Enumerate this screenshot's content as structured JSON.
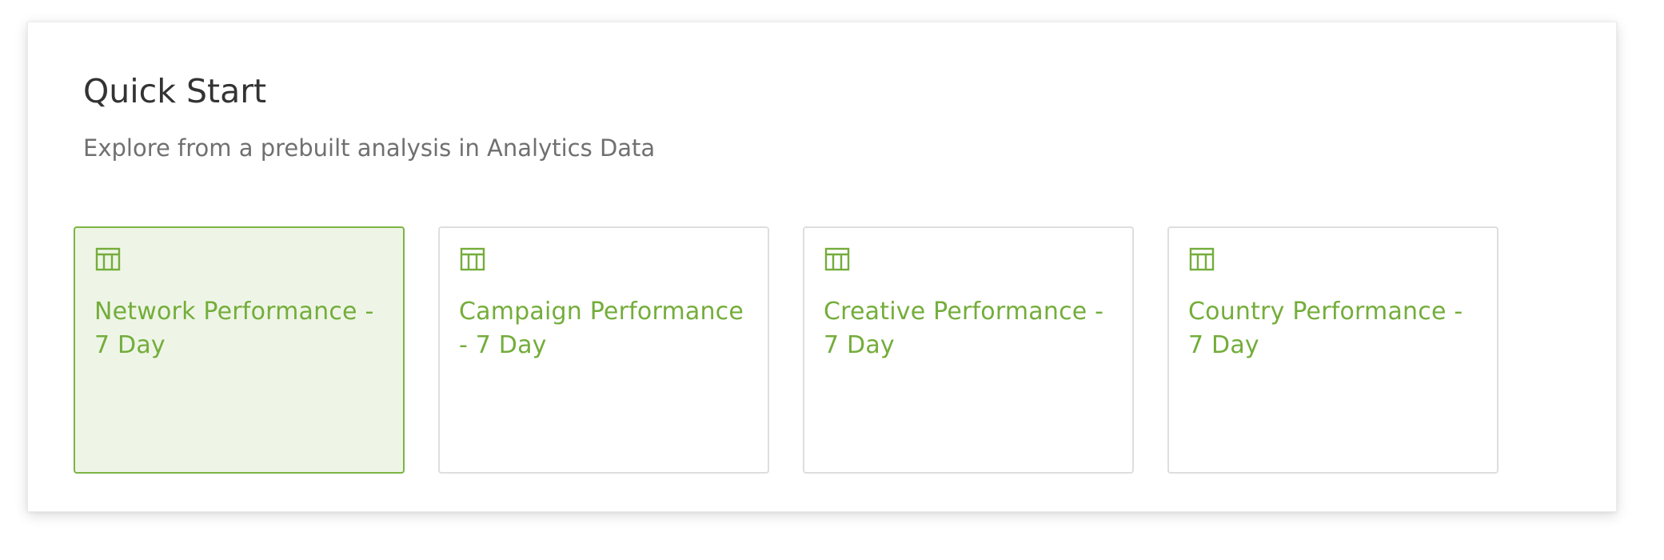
{
  "quick_start": {
    "title": "Quick Start",
    "subtitle": "Explore from a prebuilt analysis in Analytics Data",
    "cards": [
      {
        "label": "Network Performance - 7 Day",
        "icon": "table-icon",
        "selected": true
      },
      {
        "label": "Campaign Performance - 7 Day",
        "icon": "table-icon",
        "selected": false
      },
      {
        "label": "Creative Performance - 7 Day",
        "icon": "table-icon",
        "selected": false
      },
      {
        "label": "Country Performance - 7 Day",
        "icon": "table-icon",
        "selected": false
      }
    ]
  },
  "colors": {
    "accent": "#74ad3b",
    "selected_background": "#eef5e6",
    "selected_border": "#7bb544"
  }
}
